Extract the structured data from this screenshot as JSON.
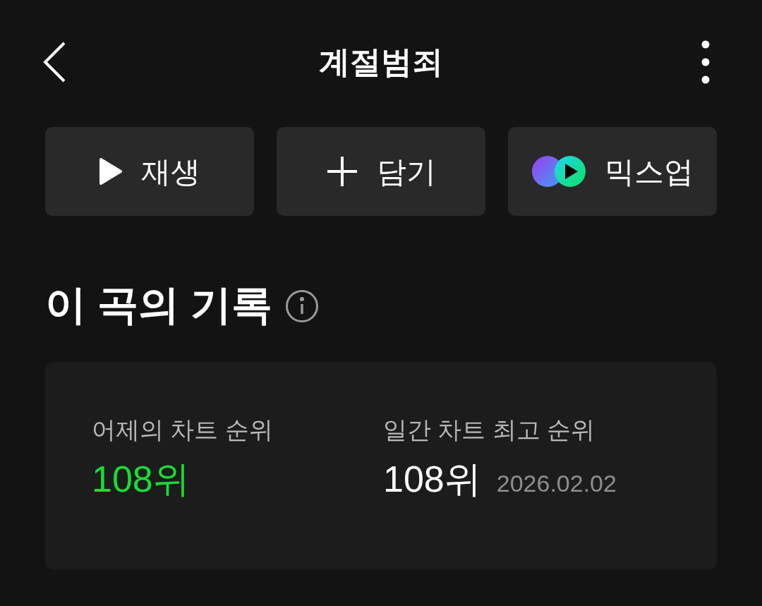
{
  "header": {
    "title": "계절범죄"
  },
  "actions": [
    {
      "kind": "play",
      "label": "재생"
    },
    {
      "kind": "add",
      "label": "담기"
    },
    {
      "kind": "mixup",
      "label": "믹스업"
    }
  ],
  "section": {
    "title": "이 곡의 기록"
  },
  "records": [
    {
      "label": "어제의 차트 순위",
      "value": "108위",
      "highlighted": true
    },
    {
      "label": "일간 차트 최고 순위",
      "value": "108위",
      "highlighted": false,
      "date": "2026.02.02"
    }
  ]
}
